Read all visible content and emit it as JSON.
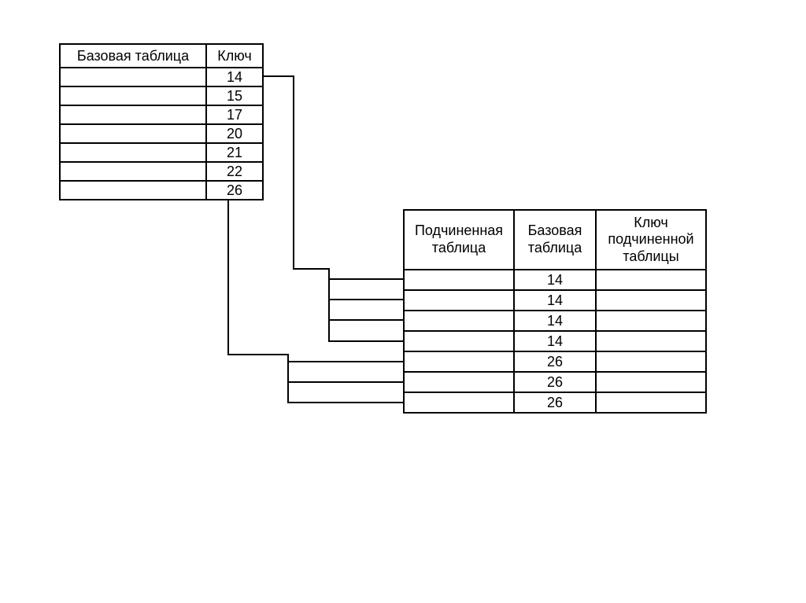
{
  "base_table": {
    "header_label": "Базовая таблица",
    "key_label": "Ключ",
    "rows": [
      {
        "key": "14"
      },
      {
        "key": "15"
      },
      {
        "key": "17"
      },
      {
        "key": "20"
      },
      {
        "key": "21"
      },
      {
        "key": "22"
      },
      {
        "key": "26"
      }
    ]
  },
  "sub_table": {
    "sub_label": "Подчиненная таблица",
    "base_label": "Базовая таблица",
    "subkey_label": "Ключ подчиненной таблицы",
    "rows": [
      {
        "fk": "14"
      },
      {
        "fk": "14"
      },
      {
        "fk": "14"
      },
      {
        "fk": "14"
      },
      {
        "fk": "26"
      },
      {
        "fk": "26"
      },
      {
        "fk": "26"
      }
    ]
  }
}
